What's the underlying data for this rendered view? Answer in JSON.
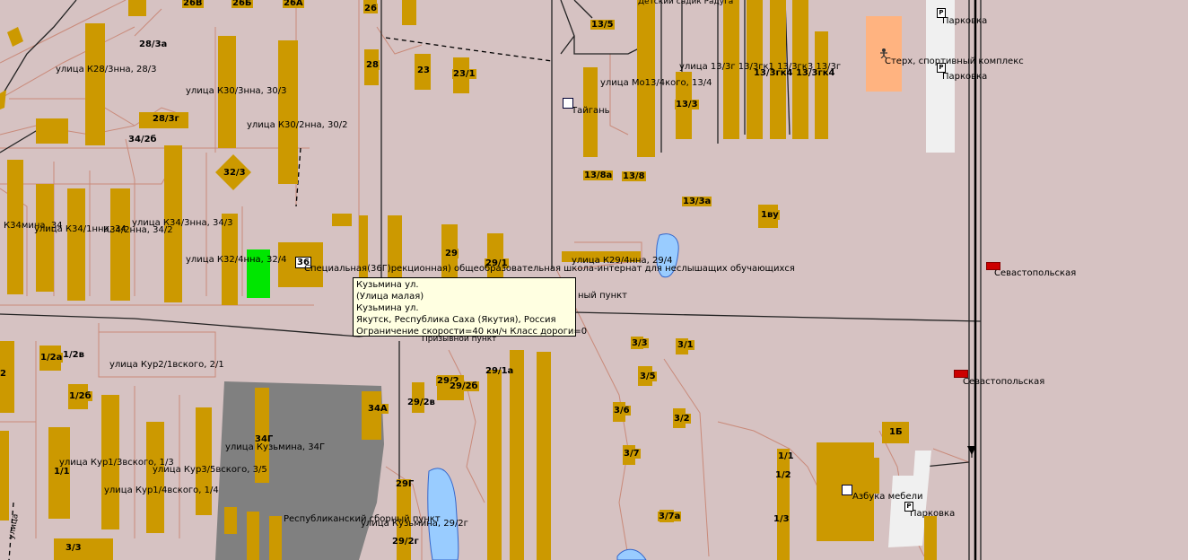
{
  "tooltip": {
    "line1": "Кузьмина ул.",
    "line2": "(Улица малая)",
    "line3": "Кузьмина ул.",
    "line4": "Якутск, Республика Саха (Якутия), Россия",
    "line5": "Ограничение скорости=40 км/ч Класс дороги=0"
  },
  "colors": {
    "background": "#d6c2c2",
    "building": "#cc9900",
    "selected_building": "#00e600",
    "industrial": "#808080",
    "water": "#99ccff",
    "sport_complex": "#ffb380",
    "parking": "#f0f0f0"
  },
  "labels": {
    "h26v": "26В",
    "h26b": "26Б",
    "h26a": "26А",
    "h26": "26",
    "h28_3a": "28/3а",
    "h28": "28",
    "h23": "23",
    "h23_1": "23/1",
    "h13_5": "13/5",
    "kindergarten": "Детский садик Радуга",
    "st_k28_3": "улица К28/3нна, 28/3",
    "st_k30_3": "улица К30/3нна, 30/3",
    "st_mo13_4": "улица Мо13/4кого, 13/4",
    "st_13_3g": "улица 13/3г 13/3гк1 13/3гк3 13/3г",
    "st_13_3gk4": "13/3гк4 13/3гк4",
    "h28_3g": "28/3г",
    "st_k30_2": "улица К30/2нна, 30/2",
    "tailor": "Тайгань",
    "h13_3": "13/3",
    "h34_2b": "34/2б",
    "h32_3": "32/3",
    "h13_8a": "13/8а",
    "h13_8": "13/8",
    "h13_3a": "13/3а",
    "h1vu": "1ву",
    "st_k34": "К34мина, 34",
    "st_k34_1": "улица К34/1нна, 34",
    "st_k34_2": "К34/2нна, 34/2",
    "st_k34_3": "улица К34/3нна, 34/3",
    "h29": "29",
    "h29_1": "29/1",
    "st_k32_4": "улица К32/4нна, 32/4",
    "h36": "36",
    "school": "Специальная(36Г)рекционная) общеобразовательная школа-интернат для неслышащих обучающихся",
    "st_k29_4": "улица К29/4нна, 29/4",
    "sport_complex": "Стерх, спортивный комплекс",
    "parking": "Парковка",
    "bus_stop": "Севастопольская",
    "point": "ный пункт",
    "point2": "Призывной пункт",
    "h1_2a": "1/2а",
    "h1_2v": "1/2в",
    "h1_2b": "1/2б",
    "h2": "2",
    "st_kur2_1": "улица Кур2/1вского, 2/1",
    "h29_1a": "29/1а",
    "h29_2": "29/2",
    "h29_2b": "29/2б",
    "h29_2v": "29/2в",
    "h34a": "34А",
    "h34g": "34Г",
    "st_kuzmina_34g": "улица Кузьмина, 34Г",
    "h3_3": "3/3",
    "h3_1": "3/1",
    "h3_5": "3/5",
    "h3_6": "3/6",
    "h3_2": "3/2",
    "h3_7": "3/7",
    "h3_7a": "3/7а",
    "h1b": "1Б",
    "h1_1": "1/1",
    "h1_2": "1/2",
    "h1_3": "1/3",
    "st_kur1_3": "улица Кур1/3вского, 1/3",
    "st_kur3_5": "улица Кур3/5вского, 3/5",
    "st_kur1_4": "улица Кур1/4вского, 1/4",
    "h1_1b": "1/1",
    "rep_point": "Республиканский сборный пункт",
    "st_29_2g": "улица Кузьмина, 29/2г",
    "h29g": "29Г",
    "h29_2g": "29/2г",
    "furniture": "Азбука мебели",
    "h3_3b": "3/3",
    "ulica": "улица"
  }
}
